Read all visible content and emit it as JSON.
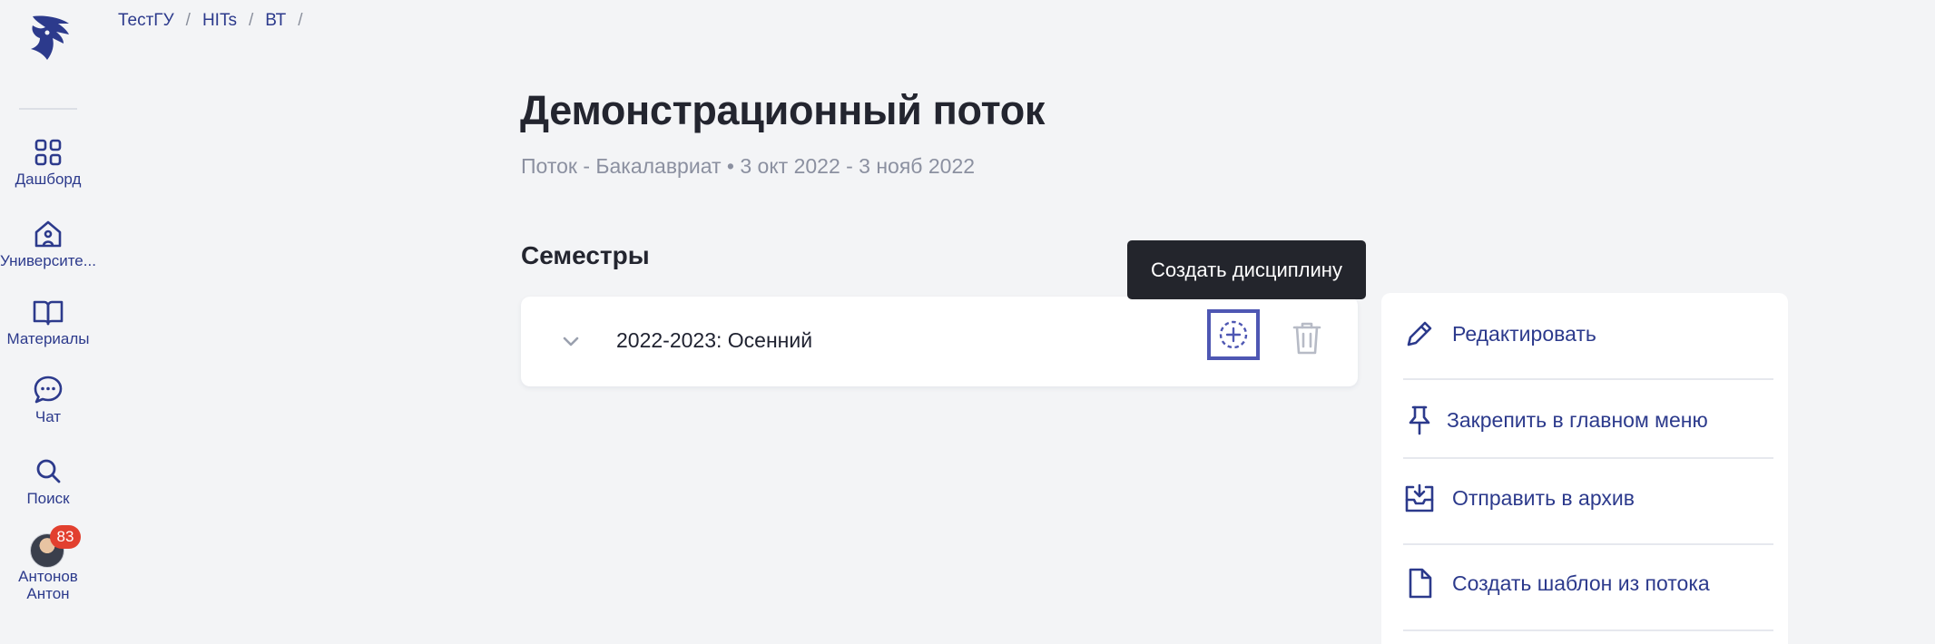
{
  "sidebar": {
    "items": [
      {
        "label": "Дашборд",
        "icon": "grid-icon"
      },
      {
        "label": "Университе...",
        "icon": "home-icon"
      },
      {
        "label": "Материалы",
        "icon": "book-icon"
      },
      {
        "label": "Чат",
        "icon": "chat-icon"
      },
      {
        "label": "Поиск",
        "icon": "search-icon"
      }
    ],
    "user": {
      "badge": "83",
      "first_line": "Антонов",
      "second_line": "Антон"
    }
  },
  "breadcrumb": {
    "items": [
      "ТестГУ",
      "HITs",
      "ВТ"
    ],
    "separator": "/"
  },
  "header": {
    "title": "Демонстрационный поток",
    "subtitle": "Поток - Бакалавриат • 3 окт 2022 - 3 нояб 2022"
  },
  "semesters": {
    "section_title": "Семестры",
    "items": [
      {
        "name": "2022-2023: Осенний"
      }
    ]
  },
  "tooltip": {
    "text": "Создать дисциплину"
  },
  "actions": {
    "items": [
      {
        "label": "Редактировать",
        "icon": "pencil-icon"
      },
      {
        "label": "Закрепить в главном меню",
        "icon": "pin-icon"
      },
      {
        "label": "Отправить в архив",
        "icon": "archive-icon"
      },
      {
        "label": "Создать шаблон из потока",
        "icon": "file-icon"
      }
    ]
  },
  "colors": {
    "background": "#f3f4f6",
    "accent": "#2c3a8c",
    "highlight_border": "#4e57b3",
    "badge": "#e2402f",
    "tooltip_bg": "#23252c",
    "muted_text": "#8b90a0"
  }
}
